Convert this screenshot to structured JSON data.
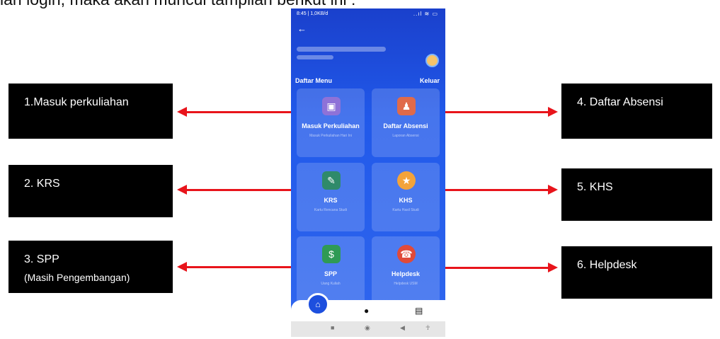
{
  "header_text": "lah login, maka akan muncul tampilan berikut ini :",
  "callouts": [
    {
      "label": "1.Masuk perkuliahan"
    },
    {
      "label": "2. KRS"
    },
    {
      "label": "3. SPP",
      "sublabel": "(Masih Pengembangan)"
    },
    {
      "label": "4. Daftar Absensi"
    },
    {
      "label": "5. KHS"
    },
    {
      "label": "6. Helpdesk"
    }
  ],
  "phone": {
    "status_time": "8:45 | 1,0KB/d",
    "status_icons": "..ıl ≋ ▭",
    "menu_title": "Daftar Menu",
    "logout_label": "Keluar",
    "cards": [
      {
        "label": "Masuk Perkuliahan",
        "sub": "Masuk Perkuliahan Hari Ini",
        "icon": "class-entry-icon",
        "color": "#8e72d8"
      },
      {
        "label": "Daftar Absensi",
        "sub": "Laporan Absensi",
        "icon": "attendance-icon",
        "color": "#e06a4a"
      },
      {
        "label": "KRS",
        "sub": "Kartu Rencana Studi",
        "icon": "study-plan-icon",
        "color": "#2f8a6a"
      },
      {
        "label": "KHS",
        "sub": "Kartu Hasil Studi",
        "icon": "grade-card-icon",
        "color": "#f3a33a"
      },
      {
        "label": "SPP",
        "sub": "Uang Kuliah",
        "icon": "money-bag-icon",
        "color": "#2f9a55"
      },
      {
        "label": "Helpdesk",
        "sub": "Helpdesk USM",
        "icon": "helpdesk-icon",
        "color": "#e04a3a"
      }
    ]
  },
  "accent_arrow_color": "#e8141b"
}
